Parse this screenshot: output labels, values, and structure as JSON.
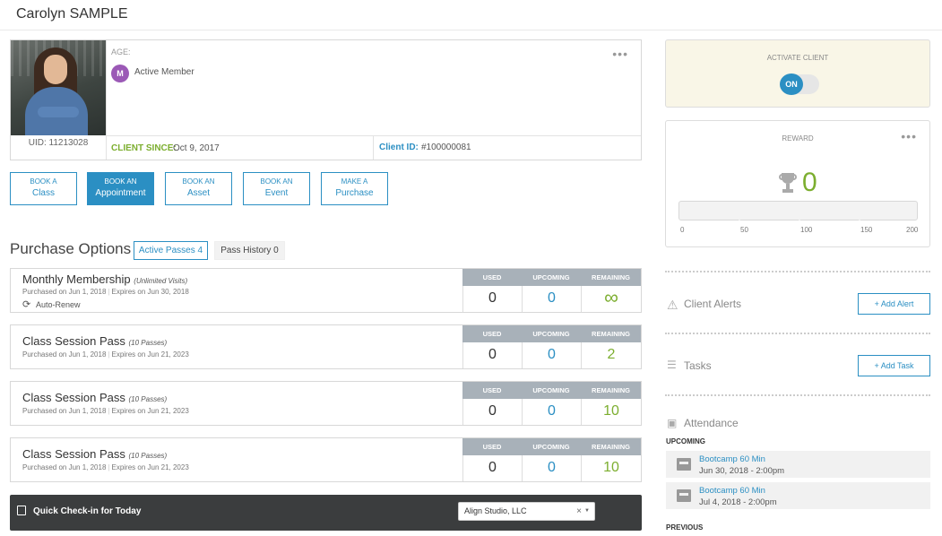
{
  "client": {
    "name": "Carolyn SAMPLE",
    "uid": "UID: 11213028",
    "age_label": "AGE:",
    "member_initial": "M",
    "member_status": "Active Member",
    "client_since_label": "CLIENT SINCE:",
    "client_since": "Oct 9, 2017",
    "client_id_label": "Client ID:",
    "client_id": "#100000081",
    "menu_glyph": "•••"
  },
  "actions": [
    {
      "small": "BOOK A",
      "big": "Class"
    },
    {
      "small": "BOOK AN",
      "big": "Appointment"
    },
    {
      "small": "BOOK AN",
      "big": "Asset"
    },
    {
      "small": "BOOK AN",
      "big": "Event"
    },
    {
      "small": "MAKE A",
      "big": "Purchase"
    }
  ],
  "purchase": {
    "title": "Purchase Options",
    "tab_active": "Active Passes 4",
    "tab_history": "Pass History 0",
    "col_used": "USED",
    "col_upcoming": "UPCOMING",
    "col_remaining": "REMAINING",
    "passes": [
      {
        "name": "Monthly Membership",
        "qualifier": "(Unlimited Visits)",
        "purchased": "Purchased on Jun 1, 2018",
        "expires": "Expires on Jun 30, 2018",
        "auto_renew": "Auto-Renew",
        "used": "0",
        "upcoming": "0",
        "remaining": "∞"
      },
      {
        "name": "Class Session Pass",
        "qualifier": "(10 Passes)",
        "purchased": "Purchased on Jun 1, 2018",
        "expires": "Expires on Jun 21, 2023",
        "used": "0",
        "upcoming": "0",
        "remaining": "2"
      },
      {
        "name": "Class Session Pass",
        "qualifier": "(10 Passes)",
        "purchased": "Purchased on Jun 1, 2018",
        "expires": "Expires on Jun 21, 2023",
        "used": "0",
        "upcoming": "0",
        "remaining": "10"
      },
      {
        "name": "Class Session Pass",
        "qualifier": "(10 Passes)",
        "purchased": "Purchased on Jun 1, 2018",
        "expires": "Expires on Jun 21, 2023",
        "used": "0",
        "upcoming": "0",
        "remaining": "10"
      }
    ]
  },
  "checkin": {
    "label": "Quick Check-in for Today",
    "location": "Align Studio, LLC",
    "clear_glyph": "×",
    "caret_glyph": "▼"
  },
  "activate": {
    "label": "ACTIVATE CLIENT",
    "toggle": "ON"
  },
  "reward": {
    "label": "REWARD",
    "points": "0",
    "progress_fraction": 0,
    "ticks": [
      "0",
      "50",
      "100",
      "150",
      "200"
    ]
  },
  "alerts": {
    "title": "Client Alerts",
    "button": "+ Add Alert",
    "icon": "warning-icon"
  },
  "tasks": {
    "title": "Tasks",
    "button": "+ Add Task",
    "icon": "clipboard-icon"
  },
  "attendance": {
    "title": "Attendance",
    "upcoming_label": "UPCOMING",
    "previous_label": "PREVIOUS",
    "visits": [
      {
        "name": "Bootcamp 60 Min",
        "date": "Jun 30, 2018 - 2:00pm"
      },
      {
        "name": "Bootcamp 60 Min",
        "date": "Jul 4, 2018 - 2:00pm"
      }
    ]
  },
  "colors": {
    "accent": "#2b8fc3",
    "success": "#7cae2f",
    "member": "#9b59b6",
    "dark_bar": "#3b3d3e"
  }
}
